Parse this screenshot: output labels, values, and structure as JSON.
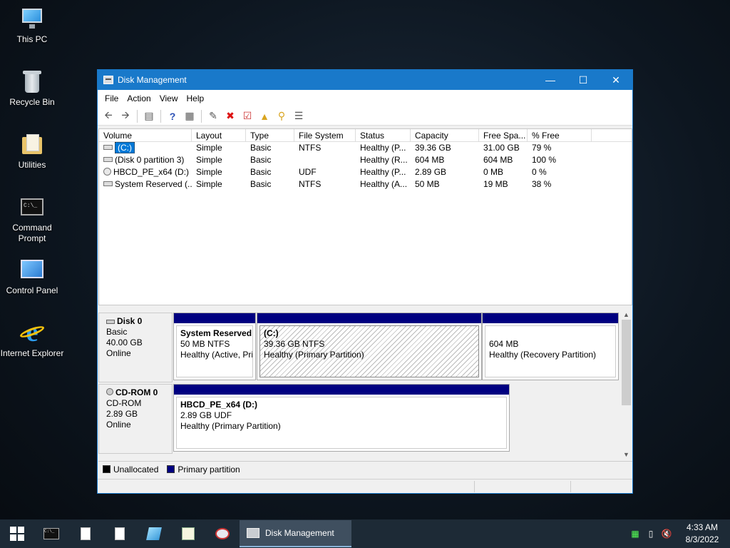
{
  "desktop": {
    "icons": [
      {
        "label": "This PC"
      },
      {
        "label": "Recycle Bin"
      },
      {
        "label": "Utilities"
      },
      {
        "label": "Command Prompt"
      },
      {
        "label": "Control Panel"
      },
      {
        "label": "Internet Explorer"
      }
    ]
  },
  "window": {
    "title": "Disk Management",
    "menu": [
      "File",
      "Action",
      "View",
      "Help"
    ],
    "columns": [
      "Volume",
      "Layout",
      "Type",
      "File System",
      "Status",
      "Capacity",
      "Free Spa...",
      "% Free"
    ],
    "volumes": [
      {
        "volume": "(C:)",
        "layout": "Simple",
        "type": "Basic",
        "fs": "NTFS",
        "status": "Healthy (P...",
        "capacity": "39.36 GB",
        "free": "31.00 GB",
        "pct": "79 %"
      },
      {
        "volume": "(Disk 0 partition 3)",
        "layout": "Simple",
        "type": "Basic",
        "fs": "",
        "status": "Healthy (R...",
        "capacity": "604 MB",
        "free": "604 MB",
        "pct": "100 %"
      },
      {
        "volume": "HBCD_PE_x64 (D:)",
        "layout": "Simple",
        "type": "Basic",
        "fs": "UDF",
        "status": "Healthy (P...",
        "capacity": "2.89 GB",
        "free": "0 MB",
        "pct": "0 %"
      },
      {
        "volume": "System Reserved (...",
        "layout": "Simple",
        "type": "Basic",
        "fs": "NTFS",
        "status": "Healthy (A...",
        "capacity": "50 MB",
        "free": "19 MB",
        "pct": "38 %"
      }
    ],
    "disks": [
      {
        "name": "Disk 0",
        "kind": "Basic",
        "size": "40.00 GB",
        "state": "Online",
        "partitions": [
          {
            "title": "System Reserved",
            "line1": "50 MB NTFS",
            "line2": "Healthy (Active, Pri"
          },
          {
            "title": "(C:)",
            "line1": "39.36 GB NTFS",
            "line2": "Healthy (Primary Partition)"
          },
          {
            "title": "",
            "line1": "604 MB",
            "line2": "Healthy (Recovery Partition)"
          }
        ]
      },
      {
        "name": "CD-ROM 0",
        "kind": "CD-ROM",
        "size": "2.89 GB",
        "state": "Online",
        "partitions": [
          {
            "title": "HBCD_PE_x64  (D:)",
            "line1": "2.89 GB UDF",
            "line2": "Healthy (Primary Partition)"
          }
        ]
      }
    ],
    "legend": [
      {
        "label": "Unallocated",
        "color": "#000000"
      },
      {
        "label": "Primary partition",
        "color": "#000080"
      }
    ]
  },
  "taskbar": {
    "active_app": "Disk Management",
    "time": "4:33 AM",
    "date": "8/3/2022"
  },
  "colors": {
    "titlebar": "#1979ca",
    "partition_bar": "#000080",
    "selection": "#0078d7"
  }
}
